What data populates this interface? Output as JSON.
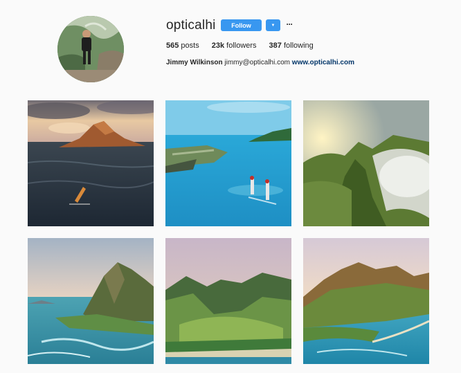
{
  "profile": {
    "username": "opticalhi",
    "follow_label": "Follow",
    "dropdown_icon": "▼",
    "more_icon": "···",
    "posts_count": "565",
    "posts_label": "posts",
    "followers_count": "23k",
    "followers_label": "followers",
    "following_count": "387",
    "following_label": "following",
    "full_name": "Jimmy Wilkinson",
    "email": "jimmy@opticalhi.com",
    "website": "www.opticalhi.com"
  },
  "colors": {
    "accent": "#3897f0",
    "link": "#003569",
    "background": "#fafafa"
  },
  "posts": [
    {
      "icon": "photo-rocky-islet-sunset"
    },
    {
      "icon": "photo-paddleboarders-lagoon"
    },
    {
      "icon": "photo-misty-ridge-sunrise"
    },
    {
      "icon": "photo-coastal-peak"
    },
    {
      "icon": "photo-green-valley"
    },
    {
      "icon": "photo-coastal-range-town"
    }
  ]
}
